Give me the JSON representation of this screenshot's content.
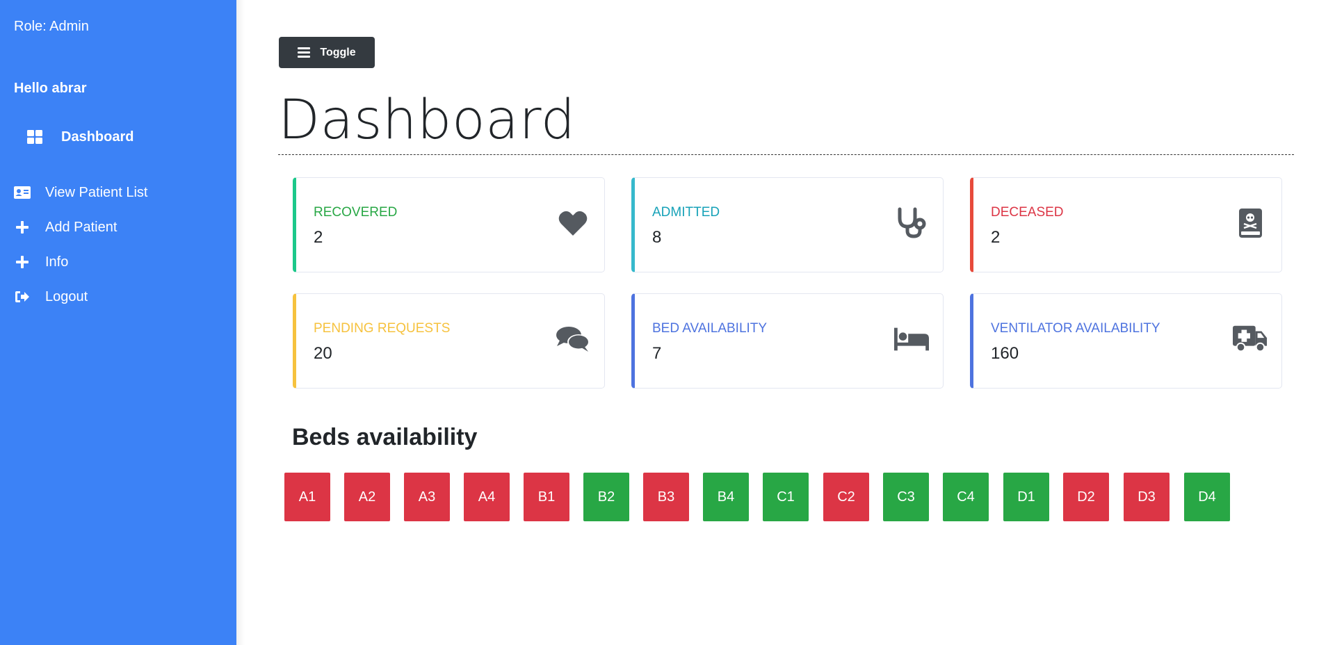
{
  "sidebar": {
    "role": "Role: Admin",
    "greeting": "Hello abrar",
    "items": [
      {
        "label": "Dashboard",
        "icon": "dashboard-grid-icon"
      },
      {
        "label": "View Patient List",
        "icon": "id-card-icon"
      },
      {
        "label": "Add Patient",
        "icon": "plus-icon"
      },
      {
        "label": "Info",
        "icon": "plus-icon"
      },
      {
        "label": "Logout",
        "icon": "sign-out-icon"
      }
    ],
    "color": "#3c82f6"
  },
  "toolbar": {
    "toggle_label": "Toggle",
    "toggle_icon": "bars-icon"
  },
  "page": {
    "title": "Dashboard"
  },
  "cards": [
    {
      "label": "RECOVERED",
      "value": "2",
      "color": "#1cc88a",
      "text_color": "#28a745",
      "icon": "heart-icon"
    },
    {
      "label": "ADMITTED",
      "value": "8",
      "color": "#36b9cc",
      "text_color": "#17a2b8",
      "icon": "stethoscope-icon"
    },
    {
      "label": "DECEASED",
      "value": "2",
      "color": "#e74a3b",
      "text_color": "#dc3545",
      "icon": "skull-book-icon"
    },
    {
      "label": "PENDING REQUESTS",
      "value": "20",
      "color": "#f6c23e",
      "text_color": "#f6c23e",
      "icon": "comments-icon"
    },
    {
      "label": "BED AVAILABILITY",
      "value": "7",
      "color": "#4e73df",
      "text_color": "#4e73df",
      "icon": "bed-icon"
    },
    {
      "label": "VENTILATOR AVAILABILITY",
      "value": "160",
      "color": "#4e73df",
      "text_color": "#4e73df",
      "icon": "ambulance-icon"
    }
  ],
  "beds": {
    "title": "Beds availability",
    "occupied_color": "#dc3545",
    "available_color": "#28a745",
    "items": [
      {
        "label": "A1",
        "status": "occupied"
      },
      {
        "label": "A2",
        "status": "occupied"
      },
      {
        "label": "A3",
        "status": "occupied"
      },
      {
        "label": "A4",
        "status": "occupied"
      },
      {
        "label": "B1",
        "status": "occupied"
      },
      {
        "label": "B2",
        "status": "available"
      },
      {
        "label": "B3",
        "status": "occupied"
      },
      {
        "label": "B4",
        "status": "available"
      },
      {
        "label": "C1",
        "status": "available"
      },
      {
        "label": "C2",
        "status": "occupied"
      },
      {
        "label": "C3",
        "status": "available"
      },
      {
        "label": "C4",
        "status": "available"
      },
      {
        "label": "D1",
        "status": "available"
      },
      {
        "label": "D2",
        "status": "occupied"
      },
      {
        "label": "D3",
        "status": "occupied"
      },
      {
        "label": "D4",
        "status": "available"
      }
    ]
  }
}
